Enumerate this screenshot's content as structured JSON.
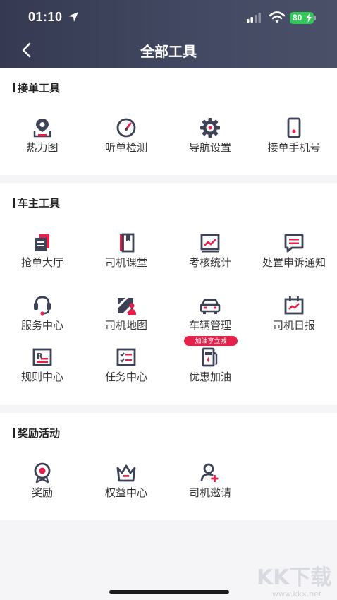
{
  "status_bar": {
    "time": "01:10",
    "battery": "80"
  },
  "header": {
    "title": "全部工具"
  },
  "sections": [
    {
      "title": "接单工具",
      "items": [
        {
          "label": "热力图",
          "icon": "heatmap-pin-icon"
        },
        {
          "label": "听单检测",
          "icon": "gauge-icon"
        },
        {
          "label": "导航设置",
          "icon": "gear-icon"
        },
        {
          "label": "接单手机号",
          "icon": "phone-icon"
        }
      ]
    },
    {
      "title": "车主工具",
      "items": [
        {
          "label": "抢单大厅",
          "icon": "order-hall-icon"
        },
        {
          "label": "司机课堂",
          "icon": "book-icon"
        },
        {
          "label": "考核统计",
          "icon": "chart-icon"
        },
        {
          "label": "处置申诉通知",
          "icon": "message-icon"
        },
        {
          "label": "服务中心",
          "icon": "headset-icon"
        },
        {
          "label": "司机地图",
          "icon": "map-icon"
        },
        {
          "label": "车辆管理",
          "icon": "car-icon"
        },
        {
          "label": "司机日报",
          "icon": "calendar-icon"
        },
        {
          "label": "规则中心",
          "icon": "rules-icon"
        },
        {
          "label": "任务中心",
          "icon": "task-list-icon"
        },
        {
          "label": "优惠加油",
          "icon": "fuel-pump-icon",
          "badge": "加油享立减"
        }
      ]
    },
    {
      "title": "奖励活动",
      "items": [
        {
          "label": "奖励",
          "icon": "medal-icon"
        },
        {
          "label": "权益中心",
          "icon": "crown-icon"
        },
        {
          "label": "司机邀请",
          "icon": "add-user-icon"
        }
      ]
    }
  ],
  "colors": {
    "accent": "#e5204a",
    "icon_dark": "#3d4257",
    "header": "#3e4359"
  },
  "watermark": {
    "text": "KK下载",
    "url_text": "www.kkx.net"
  }
}
